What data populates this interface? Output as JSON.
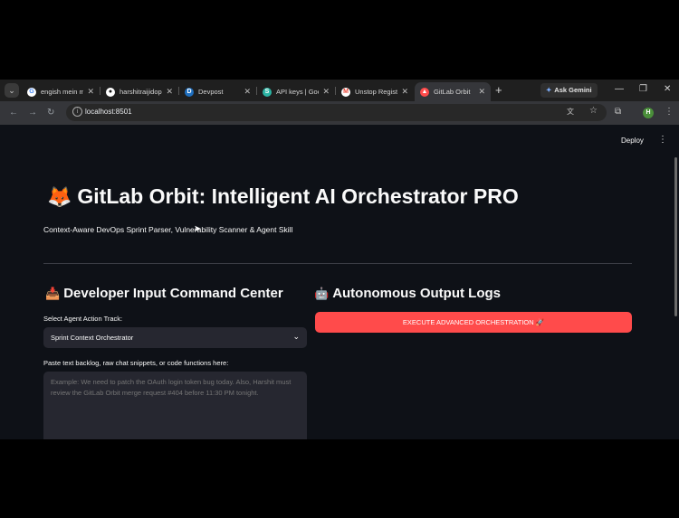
{
  "browser": {
    "tabs": [
      {
        "title": "engish mein m",
        "icon": "google-icon",
        "color": "#4285f4"
      },
      {
        "title": "harshitraijidop",
        "icon": "github-icon",
        "color": "#ffffff"
      },
      {
        "title": "Devpost",
        "icon": "devpost-icon",
        "color": "#1f6fbf"
      },
      {
        "title": "API keys | Goo",
        "icon": "api-keys-icon",
        "color": "#2bb3a3"
      },
      {
        "title": "Unstop Registr",
        "icon": "gmail-icon",
        "color": "#ea4335"
      },
      {
        "title": "GitLab Orbit",
        "icon": "streamlit-icon",
        "color": "#ff4b4b"
      }
    ],
    "ask_gemini": "Ask Gemini",
    "url": "localhost:8501",
    "avatar_initial": "H"
  },
  "app": {
    "deploy_label": "Deploy",
    "title": "GitLab Orbit: Intelligent AI Orchestrator PRO",
    "title_emoji": "🦊",
    "subtitle": "Context-Aware DevOps Sprint Parser, Vulnerability Scanner & Agent Skill",
    "left": {
      "heading": "Developer Input Command Center",
      "heading_emoji": "📥",
      "select_label": "Select Agent Action Track:",
      "select_value": "Sprint Context Orchestrator",
      "textarea_label": "Paste text backlog, raw chat snippets, or code functions here:",
      "textarea_placeholder": "Example: We need to patch the OAuth login token bug today. Also, Harshit must review the GitLab Orbit merge request #404 before 11:30 PM tonight."
    },
    "right": {
      "heading": "Autonomous Output Logs",
      "heading_emoji": "🤖",
      "execute_label": "EXECUTE ADVANCED ORCHESTRATION 🚀"
    },
    "accent_color": "#ff4b4b",
    "background_color": "#0e1117"
  }
}
